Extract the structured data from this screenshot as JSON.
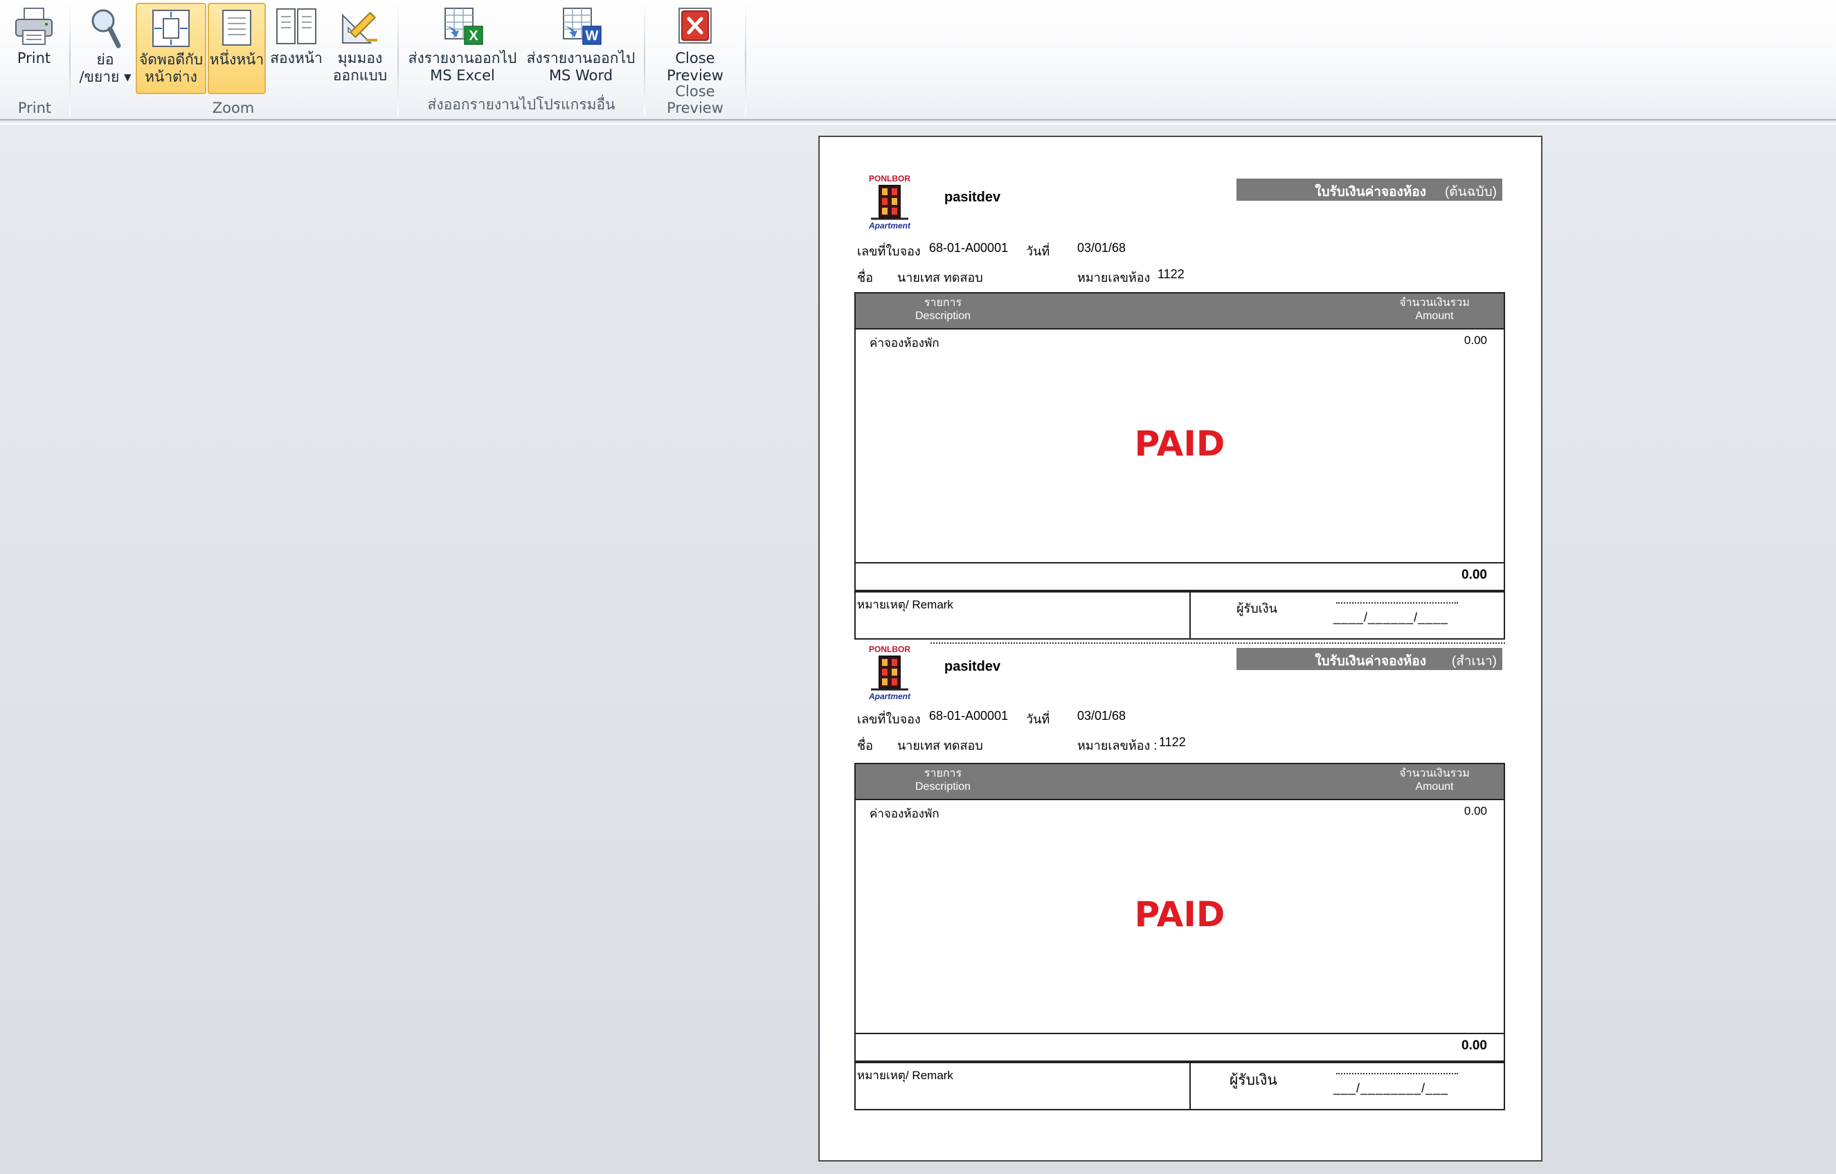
{
  "ribbon": {
    "groups": [
      {
        "label": "Print",
        "buttons": [
          {
            "label": "Print",
            "icon": "printer-icon"
          }
        ]
      },
      {
        "label": "Zoom",
        "buttons": [
          {
            "label": "ย่อ\n/ขยาย ▾",
            "icon": "magnifier-icon"
          },
          {
            "label": "จัดพอดีกับ\nหน้าต่าง",
            "icon": "fit-window-icon",
            "active": true
          },
          {
            "label": "หนึ่งหน้า",
            "icon": "one-page-icon",
            "active": true
          },
          {
            "label": "สองหน้า",
            "icon": "two-pages-icon"
          },
          {
            "label": "มุมมอง\nออกแบบ",
            "icon": "design-view-icon"
          }
        ]
      },
      {
        "label": "ส่งออกรายงานไปโปรแกรมอื่น",
        "buttons": [
          {
            "label": "ส่งรายงานออกไป\nMS Excel",
            "icon": "excel-export-icon"
          },
          {
            "label": "ส่งรายงานออกไป\nMS Word",
            "icon": "word-export-icon"
          }
        ]
      },
      {
        "label": "Close Preview",
        "buttons": [
          {
            "label": "Close\nPreview",
            "icon": "close-preview-icon"
          }
        ]
      }
    ]
  },
  "receipts": [
    {
      "company": "pasitdev",
      "logo_text": "PONLBOR",
      "logo_sub": "Apartment",
      "title": "ใบรับเงินค่าจองห้อง",
      "copy": "(ต้นฉบับ)",
      "booking_label": "เลขที่ใบจอง",
      "booking_no": "68-01-A00001",
      "date_label": "วันที่",
      "date": "03/01/68",
      "name_label": "ชื่อ",
      "name": "นายเทส ทดสอบ",
      "room_label": "หมายเลขห้อง",
      "room": "1122",
      "col1": "รายการ\nDescription",
      "col2": "จำนวนเงินรวม\nAmount",
      "item": "ค่าจองห้องพัก",
      "item_amount": "0.00",
      "stamp": "PAID",
      "total": "0.00",
      "remark_label": "หมายเหตุ/ Remark",
      "receiver_label": "ผู้รับเงิน",
      "date_blank": "____/______/____"
    },
    {
      "company": "pasitdev",
      "logo_text": "PONLBOR",
      "logo_sub": "Apartment",
      "title": "ใบรับเงินค่าจองห้อง",
      "copy": "(สำเนา)",
      "booking_label": "เลขที่ใบจอง",
      "booking_no": "68-01-A00001",
      "date_label": "วันที่",
      "date": "03/01/68",
      "name_label": "ชื่อ",
      "name": "นายเทส ทดสอบ",
      "room_label": "หมายเลขห้อง :",
      "room": "1122",
      "col1": "รายการ\nDescription",
      "col2": "จำนวนเงินรวม\nAmount",
      "item": "ค่าจองห้องพัก",
      "item_amount": "0.00",
      "stamp": "PAID",
      "total": "0.00",
      "remark_label": "หมายเหตุ/ Remark",
      "receiver_label": "ผู้รับเงิน",
      "date_blank": "___/________/___"
    }
  ],
  "colors": {
    "stamp": "#e01b22",
    "header_bar": "#7a7a7a",
    "active_button": "#fbd36e"
  }
}
